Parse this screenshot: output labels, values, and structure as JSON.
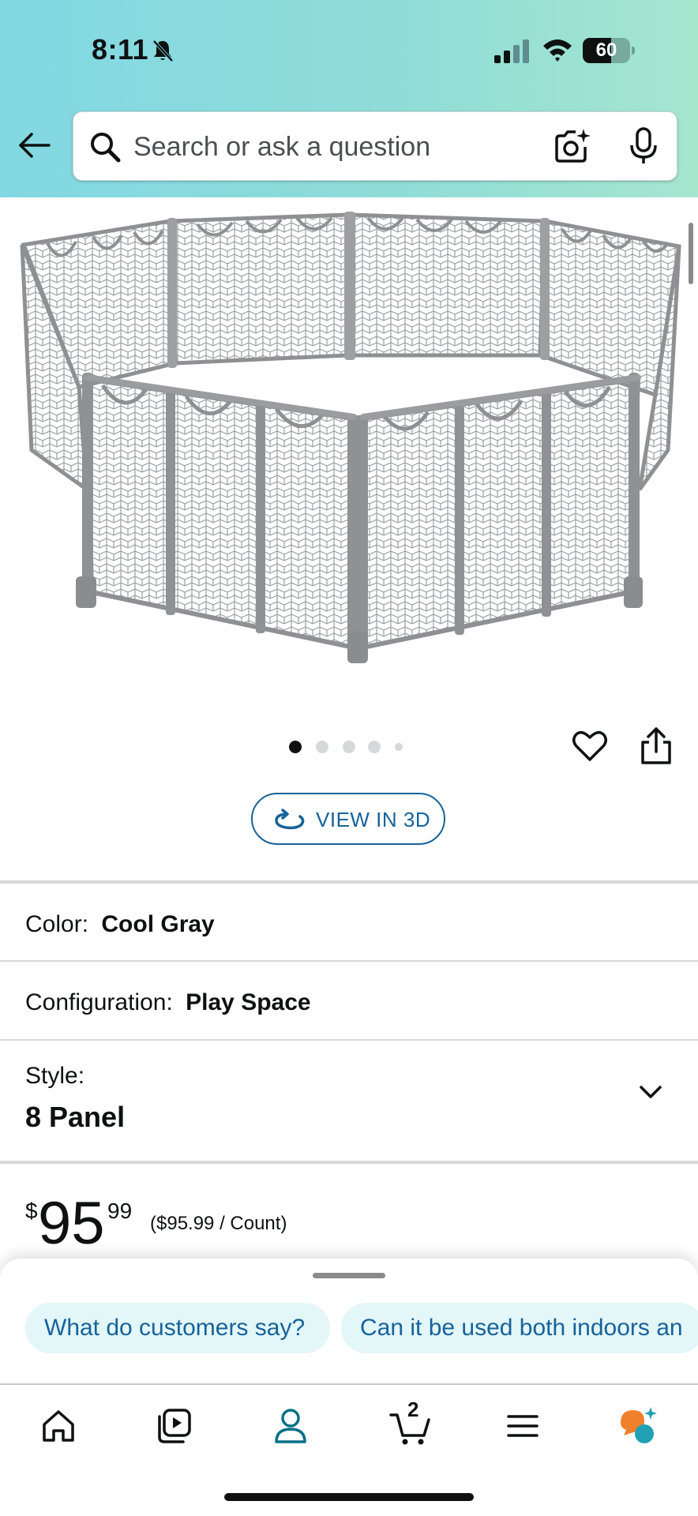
{
  "status_bar": {
    "time": "8:11",
    "battery": "60",
    "battery_level": 0.6
  },
  "search": {
    "placeholder": "Search or ask a question"
  },
  "gallery": {
    "image_count": 5,
    "active_index": 0
  },
  "view_3d": {
    "label": "VIEW IN 3D"
  },
  "options": {
    "color_label": "Color:",
    "color_value": "Cool Gray",
    "configuration_label": "Configuration:",
    "configuration_value": "Play Space",
    "style_label": "Style:",
    "style_value": "8 Panel"
  },
  "price": {
    "currency": "$",
    "whole": "95",
    "fraction": "99",
    "unit_price": "($95.99 / Count)"
  },
  "suggestions": [
    {
      "label": "What do customers say?"
    },
    {
      "label": "Can it be used both indoors an"
    }
  ],
  "nav": {
    "cart_count": "2",
    "active_tab": "account",
    "accent": "#007185"
  },
  "icons": {
    "back": "back-arrow-icon",
    "search": "search-icon",
    "camera": "camera-icon",
    "mic": "microphone-icon",
    "heart": "heart-icon",
    "share": "share-icon",
    "rotate": "rotate-3d-icon",
    "chevron": "chevron-down-icon",
    "home": "home-icon",
    "video": "video-icon",
    "account": "account-icon",
    "cart": "cart-icon",
    "menu": "menu-icon",
    "assistant": "assistant-icon"
  }
}
